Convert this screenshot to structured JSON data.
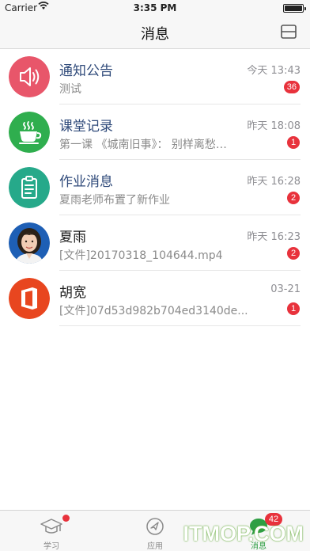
{
  "status_bar": {
    "carrier": "Carrier",
    "time": "3:35 PM"
  },
  "nav": {
    "title": "消息"
  },
  "messages": [
    {
      "title": "通知公告",
      "time": "今天 13:43",
      "preview": "测试",
      "badge": "36",
      "icon": "speaker-icon",
      "color": "#e8566a"
    },
    {
      "title": "课堂记录",
      "time": "昨天 18:08",
      "preview": "第一课 《城南旧事》：  别样离愁…",
      "badge": "1",
      "icon": "coffee-cup-icon",
      "color": "#2fae4e"
    },
    {
      "title": "作业消息",
      "time": "昨天 16:28",
      "preview": "夏雨老师布置了新作业",
      "badge": "2",
      "icon": "clipboard-icon",
      "color": "#26a98a"
    },
    {
      "title": "夏雨",
      "time": "昨天 16:23",
      "preview": "[文件]20170318_104644.mp4",
      "badge": "2",
      "icon": "user-photo",
      "color": "#1e5fb5"
    },
    {
      "title": "胡宽",
      "time": "03-21",
      "preview": "[文件]07d53d982b704ed3140de...",
      "badge": "1",
      "icon": "office-icon",
      "color": "#e8461f"
    }
  ],
  "tabs": [
    {
      "label": "学习",
      "icon": "graduation-cap-icon"
    },
    {
      "label": "应用",
      "icon": "compass-icon"
    },
    {
      "label": "消息",
      "icon": "chat-icon",
      "badge": "42"
    }
  ],
  "watermark": "ITMOP.COM"
}
